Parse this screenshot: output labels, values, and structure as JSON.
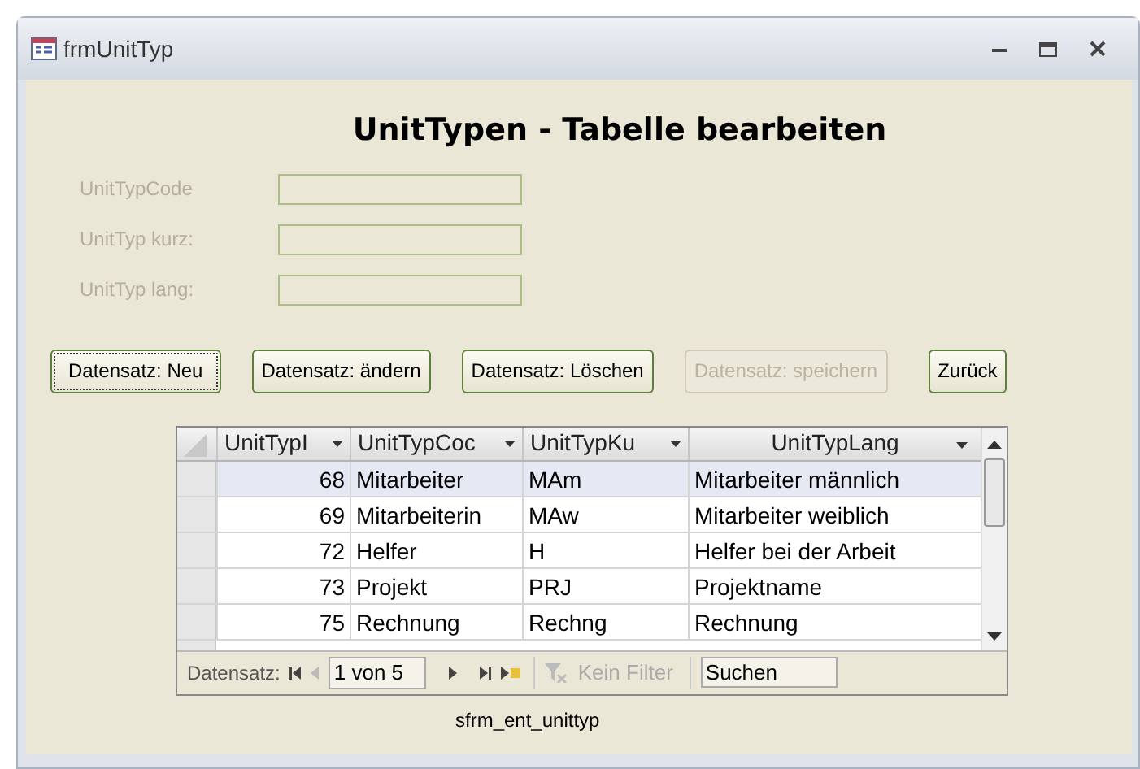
{
  "window": {
    "title": "frmUnitTyp"
  },
  "heading": "UnitTypen - Tabelle bearbeiten",
  "fields": [
    {
      "label": "UnitTypCode",
      "disabled": true
    },
    {
      "label": "UnitTyp kurz:",
      "disabled": true
    },
    {
      "label": "UnitTyp lang:",
      "disabled": true
    }
  ],
  "buttons": [
    {
      "label": "Datensatz: Neu",
      "focused": true,
      "disabled": false
    },
    {
      "label": "Datensatz: ändern",
      "focused": false,
      "disabled": false
    },
    {
      "label": "Datensatz: Löschen",
      "focused": false,
      "disabled": false
    },
    {
      "label": "Datensatz: speichern",
      "focused": false,
      "disabled": true
    },
    {
      "label": "Zurück",
      "focused": false,
      "disabled": false
    }
  ],
  "table": {
    "columns": [
      "UnitTypI",
      "UnitTypCoc",
      "UnitTypKu",
      "UnitTypLang"
    ],
    "rows": [
      {
        "cells": [
          "68",
          "Mitarbeiter",
          "MAm",
          "Mitarbeiter männlich"
        ],
        "selected": true
      },
      {
        "cells": [
          "69",
          "Mitarbeiterin",
          "MAw",
          "Mitarbeiter weiblich"
        ],
        "selected": false
      },
      {
        "cells": [
          "72",
          "Helfer",
          "H",
          "Helfer bei der Arbeit"
        ],
        "selected": false
      },
      {
        "cells": [
          "73",
          "Projekt",
          "PRJ",
          "Projektname"
        ],
        "selected": false
      },
      {
        "cells": [
          "75",
          "Rechnung",
          "Rechng",
          "Rechnung"
        ],
        "selected": false
      }
    ]
  },
  "navigation": {
    "label": "Datensatz:",
    "position": "1 von 5",
    "filter": "Kein Filter",
    "search": {
      "placeholder": "Suchen"
    }
  },
  "subform_caption": "sfrm_ent_unittyp"
}
